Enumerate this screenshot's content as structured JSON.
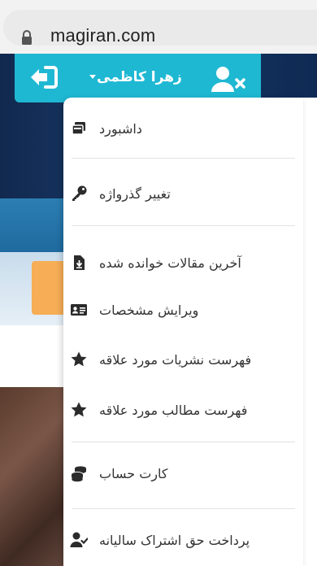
{
  "browser": {
    "url": "magiran.com"
  },
  "userbar": {
    "username": "زهرا کاظمی"
  },
  "menu": {
    "items": [
      {
        "label": "داشبورد",
        "icon": "dashboard-icon"
      },
      {
        "label": "تغییر گذرواژه",
        "icon": "key-icon"
      },
      {
        "label": "آخرین مقالات خوانده شده",
        "icon": "file-download-icon"
      },
      {
        "label": "ویرایش مشخصات",
        "icon": "id-card-icon"
      },
      {
        "label": "فهرست نشریات مورد علاقه",
        "icon": "star-icon"
      },
      {
        "label": "فهرست مطالب مورد علاقه",
        "icon": "star-icon"
      },
      {
        "label": "کارت حساب",
        "icon": "coins-icon"
      },
      {
        "label": "پرداخت حق اشتراک سالیانه",
        "icon": "user-check-icon"
      }
    ]
  },
  "colors": {
    "accent": "#1fb8d3",
    "navy": "#12294f",
    "icon": "#2b2b2b"
  }
}
